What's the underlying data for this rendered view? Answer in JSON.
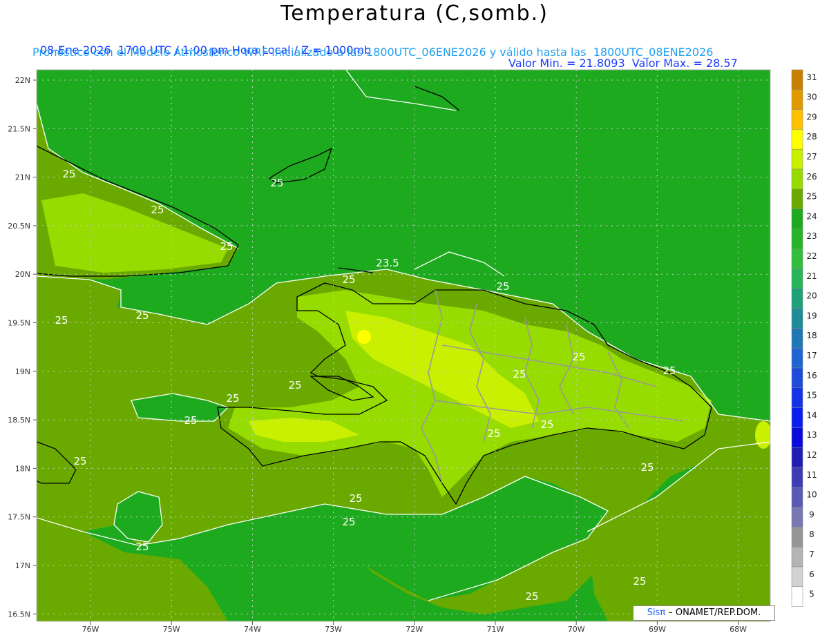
{
  "title": "Temperatura (C,somb.)",
  "subtitle_left": "08-Ene-2026  1700 UTC / 1:00 pm Hora Local / Z = 1000mb",
  "subtitle_right": "Valor Min. = 21.8093  Valor Max. = 28.57",
  "subtitle2": "Pronóstico con el Modelo Atmosferico WRF inicializado a las 1800UTC_06ENE2026 y válido hasta las  1800UTC_08ENE2026",
  "credit": {
    "logo": "Sisπ",
    "text": " – ONAMET/REP.DOM."
  },
  "lat_labels": [
    "22N",
    "21.5N",
    "21N",
    "20.5N",
    "20N",
    "19.5N",
    "19N",
    "18.5N",
    "18N",
    "17.5N",
    "17N",
    "16.5N"
  ],
  "lon_labels": [
    "76W",
    "75W",
    "74W",
    "73W",
    "72W",
    "71W",
    "70W",
    "69W",
    "68W"
  ],
  "colorbar": {
    "labels": [
      "31",
      "30",
      "29",
      "28",
      "27",
      "26",
      "25",
      "24",
      "23",
      "22",
      "21",
      "20",
      "19",
      "18",
      "17",
      "16",
      "15",
      "14",
      "13",
      "12",
      "11",
      "10",
      "9",
      "8",
      "7",
      "6",
      "5"
    ],
    "colors": [
      "#c88000",
      "#e09a00",
      "#ffc000",
      "#ffff00",
      "#c8f000",
      "#96dc00",
      "#6aaa00",
      "#1eaa1e",
      "#28b428",
      "#32be3c",
      "#28b45a",
      "#1ea078",
      "#1e8c96",
      "#1e78b4",
      "#1e64d2",
      "#1e4bdc",
      "#1432e6",
      "#0a1ef0",
      "#0a0adc",
      "#1e1eb4",
      "#3c3cb4",
      "#5a5ab4",
      "#7878b4",
      "#969696",
      "#b4b4b4",
      "#d2d2d2",
      "#ffffff"
    ]
  },
  "contour_labels": [
    "25",
    "25",
    "25",
    "25",
    "25",
    "25",
    "23.5",
    "25",
    "25",
    "25",
    "25",
    "25",
    "25",
    "25",
    "25",
    "25",
    "25",
    "25",
    "25",
    "25",
    "25",
    "25",
    "25",
    "25"
  ],
  "colors": {
    "sea_green": "#1eaa1e",
    "olive": "#6aaa00",
    "light_lime": "#96dc00",
    "lime": "#c8f000",
    "yellow": "#ffff00"
  }
}
